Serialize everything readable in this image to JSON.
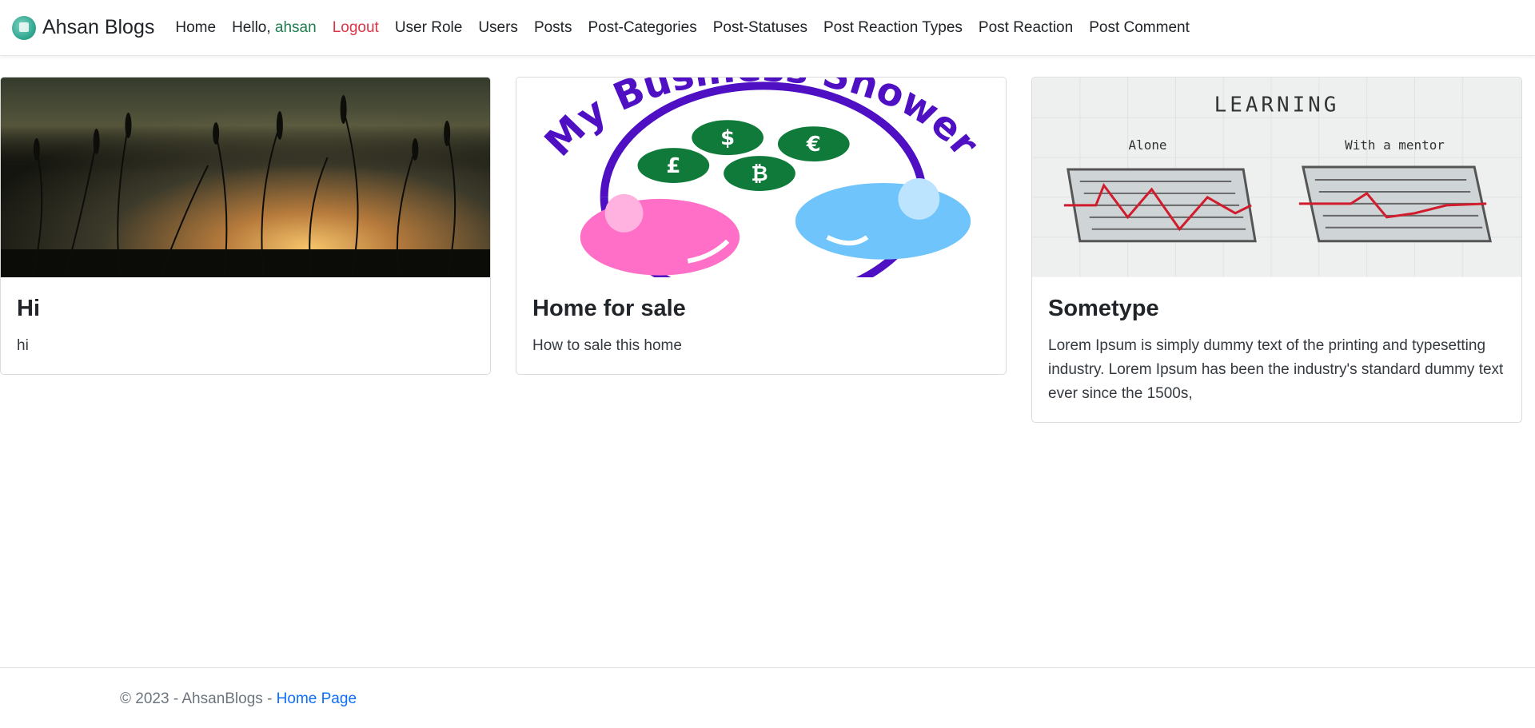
{
  "brand": {
    "name": "Ahsan Blogs",
    "logo_icon": "blog-logo-icon"
  },
  "nav": {
    "home": "Home",
    "hello_prefix": "Hello,",
    "username": "ahsan",
    "logout": "Logout",
    "items": [
      "User Role",
      "Users",
      "Posts",
      "Post-Categories",
      "Post-Statuses",
      "Post Reaction Types",
      "Post Reaction",
      "Post Comment"
    ]
  },
  "posts": [
    {
      "title": "Hi",
      "text": "hi",
      "image": "sunset-grass-silhouette"
    },
    {
      "title": "Home for sale",
      "text": "How to sale this home",
      "image": "my-business-shower-logo",
      "image_text": "My Business Shower"
    },
    {
      "title": "Sometype",
      "text": "Lorem Ipsum is simply dummy text of the printing and typesetting industry. Lorem Ipsum has been the industry's standard dummy text ever since the 1500s,",
      "image": "learning-maze",
      "image_caption": {
        "heading": "LEARNING",
        "left": "Alone",
        "right": "With a mentor"
      }
    }
  ],
  "footer": {
    "copyright": "© 2023 - AhsanBlogs -",
    "link": "Home Page"
  },
  "colors": {
    "logout": "#dc3545",
    "username": "#1e7e4f",
    "link": "#0d6efd"
  }
}
